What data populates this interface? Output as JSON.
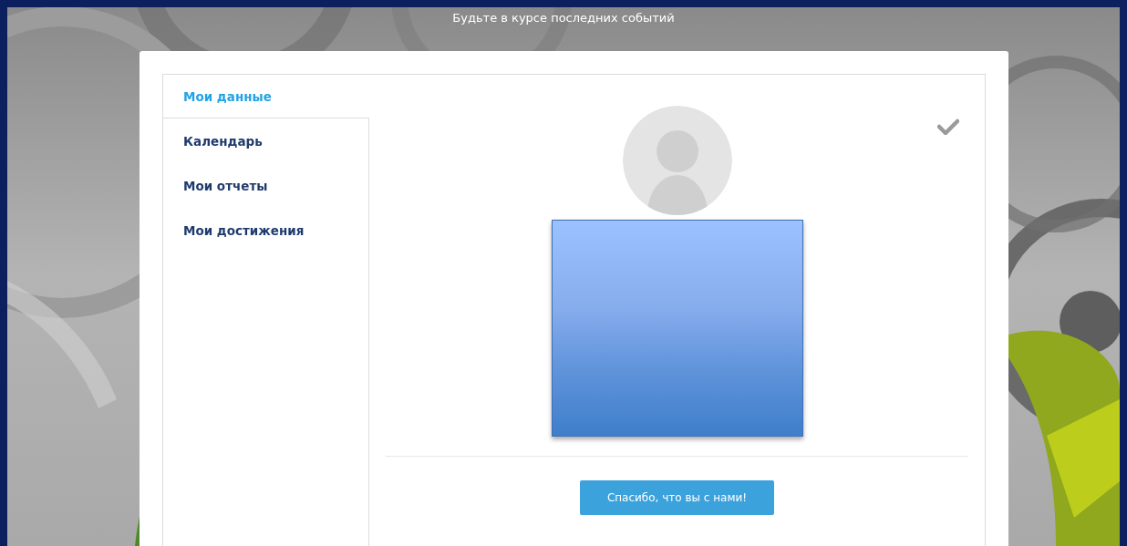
{
  "header": {
    "tagline": "Будьте в курсе последних событий"
  },
  "tabs": [
    {
      "label": "Мои данные",
      "selected": true
    },
    {
      "label": "Календарь",
      "selected": false
    },
    {
      "label": "Мои отчеты",
      "selected": false
    },
    {
      "label": "Мои достижения",
      "selected": false
    }
  ],
  "profile": {
    "action_button": "Спасибо, что вы с нами!"
  }
}
